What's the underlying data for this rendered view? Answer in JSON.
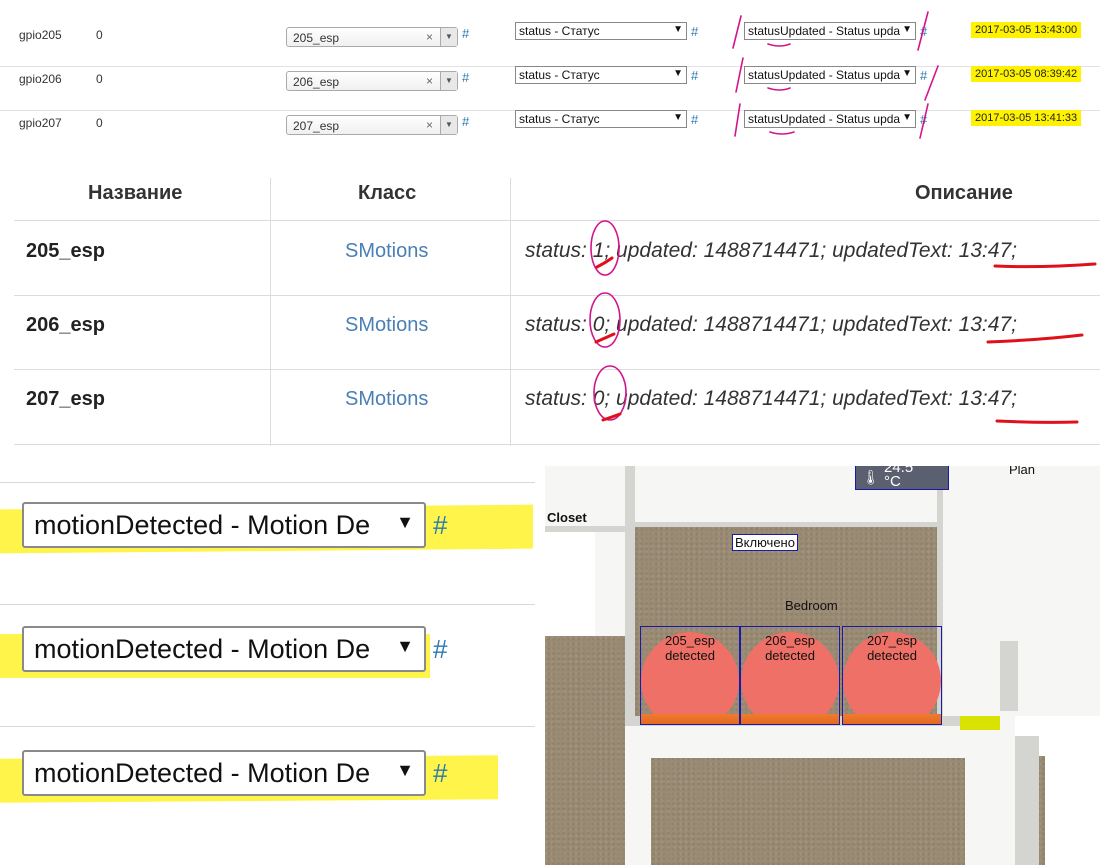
{
  "config_rows": [
    {
      "gpio": "gpio205",
      "value": "0",
      "object": "205_esp",
      "property": "status - Статус",
      "method": "statusUpdated - Status upda",
      "updated": "2017-03-05 13:43:00"
    },
    {
      "gpio": "gpio206",
      "value": "0",
      "object": "206_esp",
      "property": "status - Статус",
      "method": "statusUpdated - Status upda",
      "updated": "2017-03-05 08:39:42"
    },
    {
      "gpio": "gpio207",
      "value": "0",
      "object": "207_esp",
      "property": "status - Статус",
      "method": "statusUpdated - Status upda",
      "updated": "2017-03-05 13:41:33"
    }
  ],
  "common": {
    "hash": "#",
    "clear": "×",
    "arrow": "▼"
  },
  "devices": {
    "headers": {
      "name": "Название",
      "class": "Класс",
      "description": "Описание"
    },
    "rows": [
      {
        "name": "205_esp",
        "class": "SMotions",
        "description": "status: 1; updated: 1488714471; updatedText: 13:47;"
      },
      {
        "name": "206_esp",
        "class": "SMotions",
        "description": "status: 0; updated: 1488714471; updatedText: 13:47;"
      },
      {
        "name": "207_esp",
        "class": "SMotions",
        "description": "status: 0; updated: 1488714471; updatedText: 13:47;"
      }
    ]
  },
  "motion_selects": [
    {
      "value": "motionDetected - Motion De"
    },
    {
      "value": "motionDetected - Motion De"
    },
    {
      "value": "motionDetected - Motion De"
    }
  ],
  "plan": {
    "thermo_text": "24.5",
    "thermo_unit": "°C",
    "plan_corner": "Plan",
    "closet": "Closet",
    "status_tag": "Включено",
    "room": "Bedroom",
    "sensors": [
      {
        "name": "205_esp",
        "state": "detected"
      },
      {
        "name": "206_esp",
        "state": "detected"
      },
      {
        "name": "207_esp",
        "state": "detected"
      }
    ]
  },
  "colors": {
    "highlight": "#fff200",
    "link": "#4a7fb5",
    "annotation_pink": "#d4148c",
    "annotation_red": "#e0101a",
    "sensor_border": "#1a1aa8",
    "sensor_fill": "#ee7066"
  }
}
